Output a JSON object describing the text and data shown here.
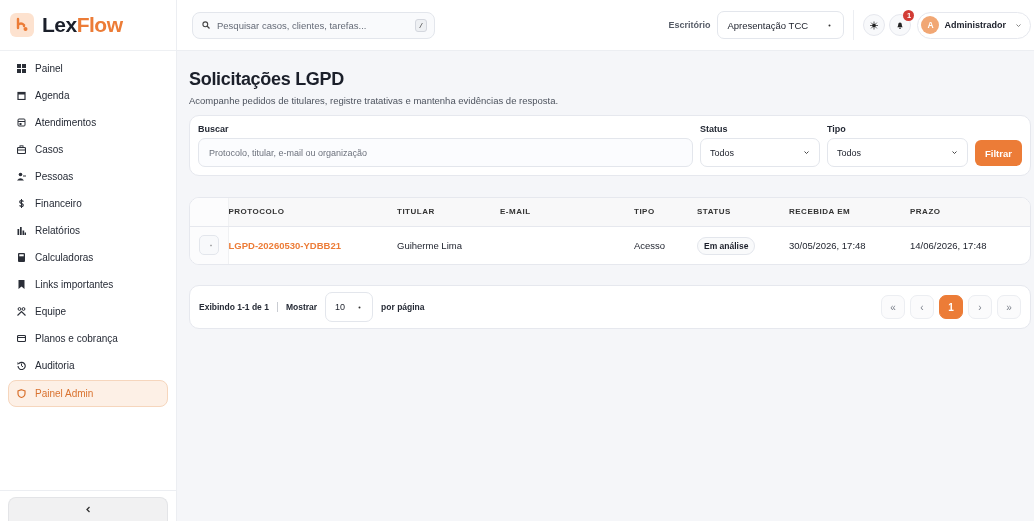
{
  "brand": {
    "name": "Lex",
    "name_accent": "Flow"
  },
  "sidebar": {
    "items": [
      {
        "label": "Painel",
        "selected": false
      },
      {
        "label": "Agenda",
        "selected": false
      },
      {
        "label": "Atendimentos",
        "selected": false
      },
      {
        "label": "Casos",
        "selected": false
      },
      {
        "label": "Pessoas",
        "selected": false
      },
      {
        "label": "Financeiro",
        "selected": false
      },
      {
        "label": "Relatórios",
        "selected": false
      },
      {
        "label": "Calculadoras",
        "selected": false
      },
      {
        "label": "Links importantes",
        "selected": false
      },
      {
        "label": "Equipe",
        "selected": false
      },
      {
        "label": "Planos e cobrança",
        "selected": false
      },
      {
        "label": "Auditoria",
        "selected": false
      },
      {
        "label": "Painel Admin",
        "selected": true
      }
    ]
  },
  "topbar": {
    "search": {
      "placeholder": "Pesquisar casos, clientes, tarefas...",
      "shortcut": "/"
    },
    "office": {
      "label": "Escritório",
      "value": "Apresentação TCC"
    },
    "notifications": {
      "count": "1"
    },
    "user": {
      "initial": "A",
      "name": "Administrador"
    }
  },
  "page": {
    "title": "Solicitações LGPD",
    "subtitle": "Acompanhe pedidos de titulares, registre tratativas e mantenha evidências de resposta."
  },
  "filters": {
    "search": {
      "label": "Buscar",
      "placeholder": "Protocolo, titular, e-mail ou organização"
    },
    "status": {
      "label": "Status",
      "value": "Todos"
    },
    "type": {
      "label": "Tipo",
      "value": "Todos"
    },
    "button": "Filtrar"
  },
  "table": {
    "columns": [
      "PROTOCOLO",
      "TITULAR",
      "E-MAIL",
      "TIPO",
      "STATUS",
      "RECEBIDA EM",
      "PRAZO"
    ],
    "rows": [
      {
        "protocol": "LGPD-20260530-YDBB21",
        "holder": "Guiherme Lima",
        "type": "Acesso",
        "status": "Em análise",
        "received": "30/05/2026, 17:48",
        "deadline": "14/06/2026, 17:48"
      }
    ]
  },
  "pagination": {
    "summary": "Exibindo 1-1 de 1",
    "show_label": "Mostrar",
    "page_size": "10",
    "per_page": "por página",
    "buttons": [
      {
        "label": "«",
        "selected": false,
        "disabled": true
      },
      {
        "label": "‹",
        "selected": false,
        "disabled": true
      },
      {
        "label": "1",
        "selected": true,
        "disabled": false
      },
      {
        "label": "›",
        "selected": false,
        "disabled": true
      },
      {
        "label": "»",
        "selected": false,
        "disabled": true
      }
    ]
  }
}
